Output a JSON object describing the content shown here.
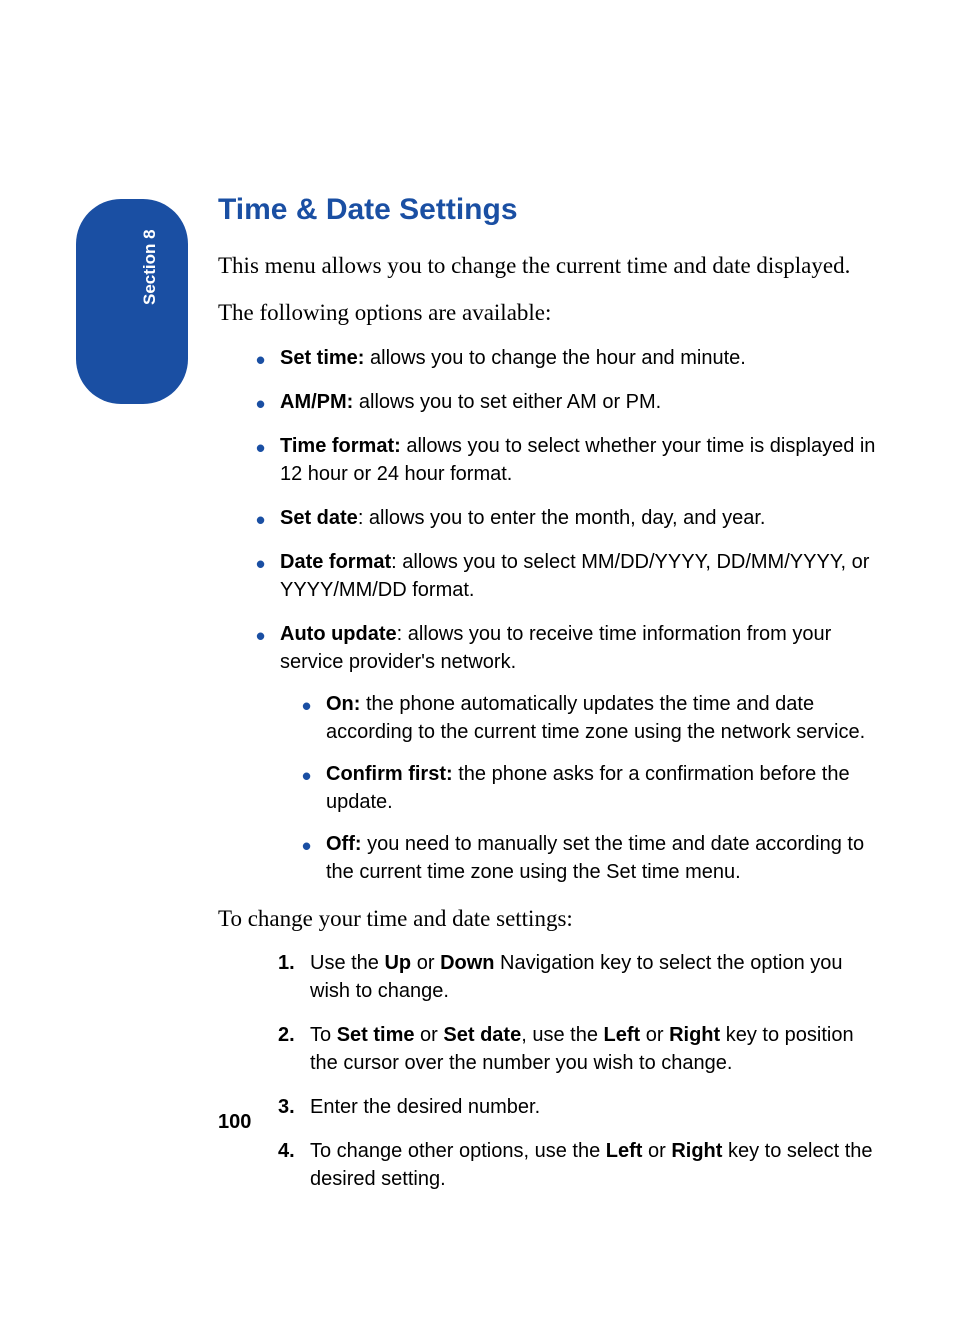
{
  "section_tab": "Section 8",
  "heading": "Time & Date Settings",
  "intro1": "This menu allows you to change the current time and date displayed.",
  "intro2": "The following options are available:",
  "bullets": [
    {
      "term": "Set time:",
      "desc": " allows you to change the hour and minute."
    },
    {
      "term": "AM/PM:",
      "desc": " allows you to set either AM or PM."
    },
    {
      "term": "Time format:",
      "desc": " allows you to select whether your time is displayed in 12 hour or 24 hour format."
    },
    {
      "term": "Set date",
      "desc": ": allows you to enter the month, day, and year."
    },
    {
      "term": "Date format",
      "desc": ": allows you to select MM/DD/YYYY, DD/MM/YYYY, or YYYY/MM/DD format."
    },
    {
      "term": "Auto update",
      "desc": ": allows you to receive time information from your service provider's network."
    }
  ],
  "sub_bullets": [
    {
      "term": "On:",
      "desc": " the phone automatically updates the time and date according to the current time zone using the network service."
    },
    {
      "term": "Confirm first:",
      "desc": " the phone asks for a confirmation before the update."
    },
    {
      "term": "Off:",
      "desc": " you need to manually set the time and date according to the current time zone using the Set time menu."
    }
  ],
  "transition": "To change your time and date settings:",
  "steps": [
    {
      "num": "1.",
      "parts": [
        {
          "t": "Use the ",
          "b": false
        },
        {
          "t": "Up",
          "b": true
        },
        {
          "t": " or ",
          "b": false
        },
        {
          "t": "Down",
          "b": true
        },
        {
          "t": " Navigation key to select the option you wish to change.",
          "b": false
        }
      ]
    },
    {
      "num": "2.",
      "parts": [
        {
          "t": "To ",
          "b": false
        },
        {
          "t": "Set time",
          "b": true
        },
        {
          "t": " or ",
          "b": false
        },
        {
          "t": "Set date",
          "b": true
        },
        {
          "t": ", use the ",
          "b": false
        },
        {
          "t": "Left",
          "b": true
        },
        {
          "t": " or ",
          "b": false
        },
        {
          "t": "Right",
          "b": true
        },
        {
          "t": " key to position the cursor over the number you wish to change.",
          "b": false
        }
      ]
    },
    {
      "num": "3.",
      "parts": [
        {
          "t": "Enter the desired number.",
          "b": false
        }
      ]
    },
    {
      "num": "4.",
      "parts": [
        {
          "t": "To change other options, use the ",
          "b": false
        },
        {
          "t": "Left",
          "b": true
        },
        {
          "t": " or ",
          "b": false
        },
        {
          "t": "Right",
          "b": true
        },
        {
          "t": " key to select the desired setting.",
          "b": false
        }
      ]
    }
  ],
  "page_number": "100"
}
